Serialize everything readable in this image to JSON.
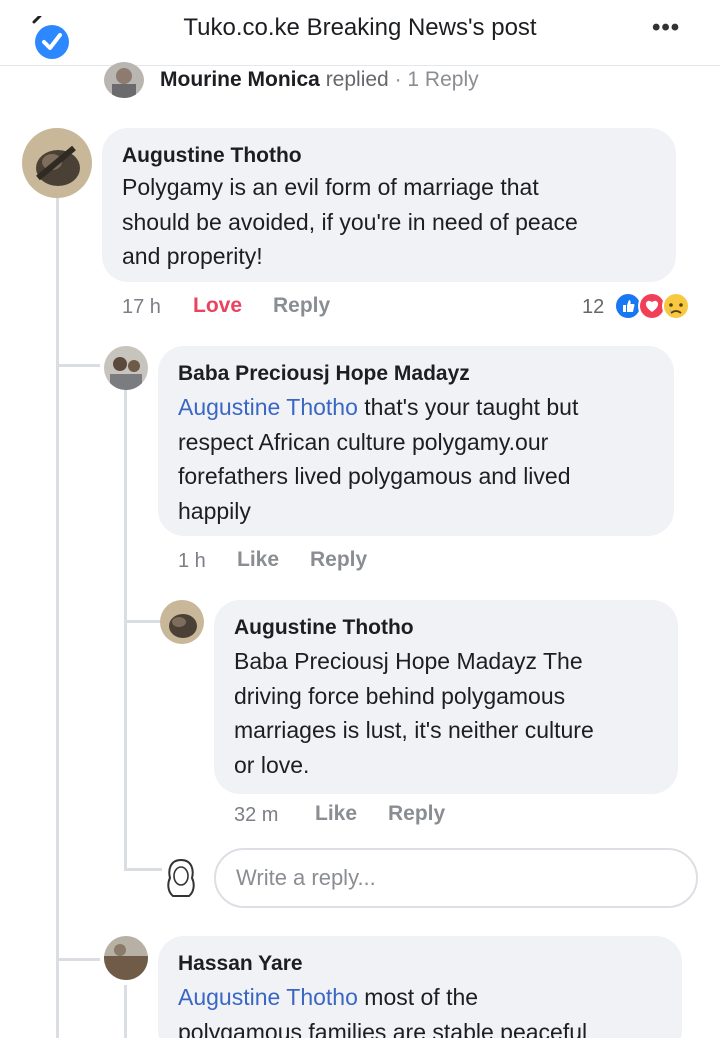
{
  "header": {
    "title": "Tuko.co.ke Breaking News's post",
    "more_label": "•••"
  },
  "top_reply": {
    "name": "Mourine Monica",
    "action": "replied",
    "separator": "·",
    "count": "1 Reply"
  },
  "comments": [
    {
      "author": "Augustine Thotho",
      "text_lines": [
        "Polygamy is an evil form of marriage that",
        "should be avoided, if you're in need of peace",
        "and properity!"
      ],
      "time": "17 h",
      "reaction_action": "Love",
      "reply_action": "Reply",
      "reaction_count": "12"
    },
    {
      "author": "Baba Preciousj  Hope Madayz",
      "mention": "Augustine Thotho",
      "text_lines": [
        " that's your taught but",
        "respect African culture polygamy.our",
        "forefathers lived polygamous and lived",
        "happily"
      ],
      "time": "1 h",
      "like_action": "Like",
      "reply_action": "Reply"
    },
    {
      "author": "Augustine Thotho",
      "text_lines": [
        "Baba Preciousj Hope Madayz The",
        "driving force behind polygamous",
        "marriages is lust, it's neither culture",
        "or love."
      ],
      "time": "32 m",
      "like_action": "Like",
      "reply_action": "Reply"
    },
    {
      "author": "Hassan Yare",
      "mention": "Augustine Thotho",
      "text_lines": [
        " most of the",
        "polygamous families are stable peaceful"
      ]
    }
  ],
  "reply_box": {
    "placeholder": "Write a reply..."
  },
  "colors": {
    "mention": "#3b67c4",
    "love": "#e8445f",
    "bubble": "#f0f2f5",
    "like_reaction": "#1877f2",
    "love_reaction": "#f33e58",
    "sad_reaction": "#f7c940"
  },
  "icons": [
    "back-check-icon",
    "more-options-icon",
    "like-reaction-icon",
    "love-reaction-icon",
    "sad-reaction-icon"
  ]
}
